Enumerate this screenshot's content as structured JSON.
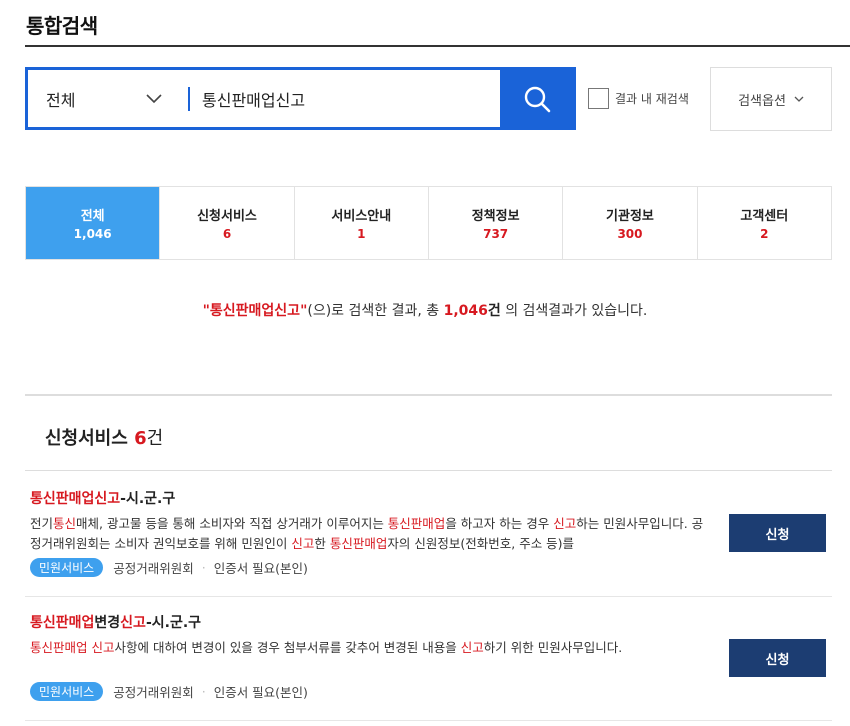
{
  "page": {
    "title": "통합검색"
  },
  "search": {
    "scope_label": "전체",
    "query": "통신판매업신고",
    "research_label": "결과 내 재검색",
    "options_label": "검색옵션"
  },
  "tabs": [
    {
      "label": "전체",
      "count": "1,046",
      "active": true
    },
    {
      "label": "신청서비스",
      "count": "6",
      "active": false
    },
    {
      "label": "서비스안내",
      "count": "1",
      "active": false
    },
    {
      "label": "정책정보",
      "count": "737",
      "active": false
    },
    {
      "label": "기관정보",
      "count": "300",
      "active": false
    },
    {
      "label": "고객센터",
      "count": "2",
      "active": false
    }
  ],
  "summary": {
    "keyword": "\"통신판매업신고\"",
    "text1": "(으)로 검색한 결과, 총 ",
    "total": "1,046",
    "unit": "건",
    "text2": " 의 검색결과가 있습니다."
  },
  "section": {
    "title": "신청서비스",
    "count": "6",
    "unit": "건"
  },
  "results": [
    {
      "title_parts": [
        {
          "text": "통신판매업신고",
          "hl": true
        },
        {
          "text": "-시.군.구",
          "hl": false
        }
      ],
      "desc_parts": [
        {
          "text": "전기",
          "hl": false
        },
        {
          "text": "통신",
          "hl": true
        },
        {
          "text": "매체, 광고물 등을 통해 소비자와 직접 상거래가 이루어지는 ",
          "hl": false
        },
        {
          "text": "통신판매업",
          "hl": true
        },
        {
          "text": "을 하고자 하는 경우 ",
          "hl": false
        },
        {
          "text": "신고",
          "hl": true
        },
        {
          "text": "하는 민원사무입니다. 공정거래위원회는 소비자 권익보호를 위해 민원인이 ",
          "hl": false
        },
        {
          "text": "신고",
          "hl": true
        },
        {
          "text": "한 ",
          "hl": false
        },
        {
          "text": "통신판매업",
          "hl": true
        },
        {
          "text": "자의 신원정보(전화번호, 주소 등)를",
          "hl": false
        }
      ],
      "badge": "민원서비스",
      "agency": "공정거래위원회",
      "cert": "인증서 필요(본인)",
      "button": "신청"
    },
    {
      "title_parts": [
        {
          "text": "통신판매업",
          "hl": true
        },
        {
          "text": "변경",
          "hl": false
        },
        {
          "text": "신고",
          "hl": true
        },
        {
          "text": "-시.군.구",
          "hl": false
        }
      ],
      "desc_parts": [
        {
          "text": "통신판매업 신고",
          "hl": true
        },
        {
          "text": "사항에 대하여 변경이 있을 경우 첨부서류를 갖추어 변경된 내용을 ",
          "hl": false
        },
        {
          "text": "신고",
          "hl": true
        },
        {
          "text": "하기 위한 민원사무입니다.",
          "hl": false
        }
      ],
      "badge": "민원서비스",
      "agency": "공정거래위원회",
      "cert": "인증서 필요(본인)",
      "button": "신청"
    }
  ],
  "colors": {
    "primary_blue": "#1a63d8",
    "tab_active": "#3ea0ee",
    "highlight_red": "#d71920",
    "apply_button": "#1c3d72"
  }
}
